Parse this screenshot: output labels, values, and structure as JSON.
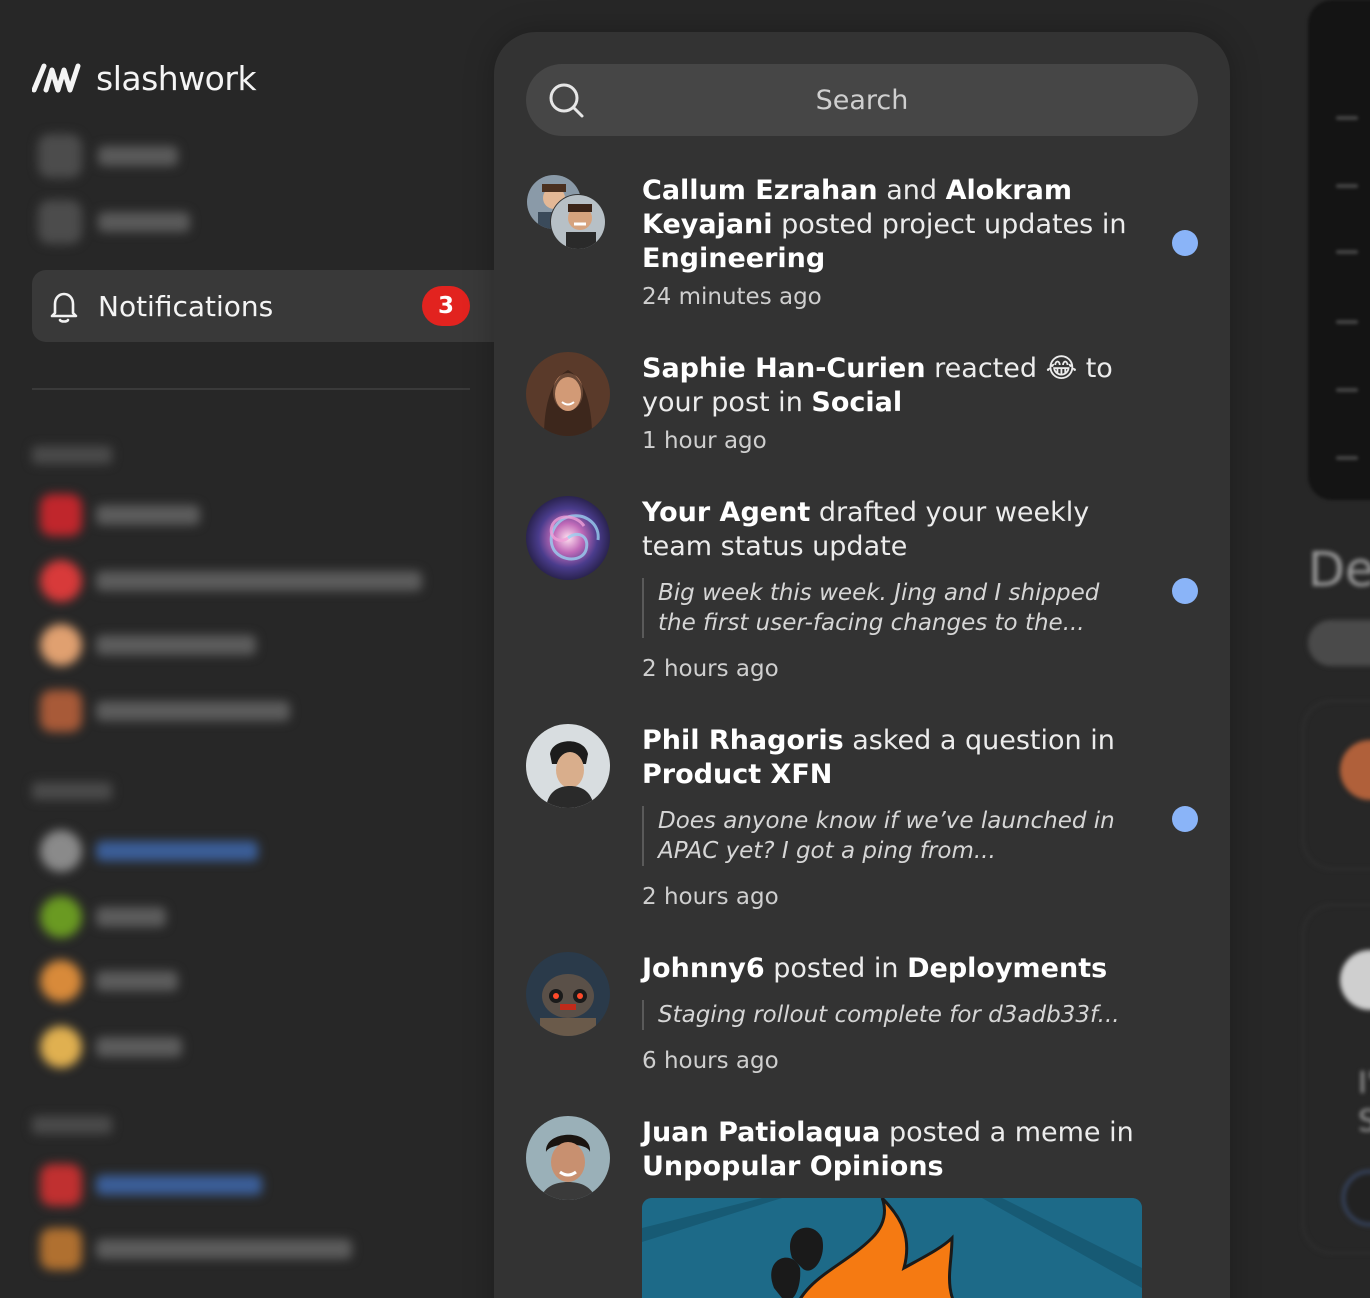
{
  "app": {
    "brand_name": "slashwork",
    "accent": "#8ab4f8",
    "badge_color": "#e2231f"
  },
  "sidebar": {
    "active_item": {
      "label": "Notifications",
      "icon": "bell-icon",
      "badge_count": "3"
    }
  },
  "search": {
    "placeholder": "Search",
    "icon": "search-icon"
  },
  "notifications": [
    {
      "parts": [
        {
          "t": "Callum Ezrahan",
          "b": true
        },
        {
          "t": " and ",
          "b": false
        },
        {
          "t": "Alokram Keyajani",
          "b": true
        },
        {
          "t": " posted project updates in ",
          "b": false
        },
        {
          "t": "Engineering",
          "b": true
        }
      ],
      "time": "24 minutes ago",
      "unread": true
    },
    {
      "parts": [
        {
          "t": "Saphie Han-Curien",
          "b": true
        },
        {
          "t": " reacted 😂 to your post in ",
          "b": false
        },
        {
          "t": "Social",
          "b": true
        }
      ],
      "time": "1 hour ago",
      "unread": false
    },
    {
      "parts": [
        {
          "t": "Your Agent",
          "b": true
        },
        {
          "t": " drafted your weekly team status update",
          "b": false
        }
      ],
      "quote": "Big week this week. Jing and I shipped the first user-facing changes to the...",
      "time": "2 hours ago",
      "unread": true
    },
    {
      "parts": [
        {
          "t": "Phil Rhagoris",
          "b": true
        },
        {
          "t": " asked a question in ",
          "b": false
        },
        {
          "t": "Product XFN",
          "b": true
        }
      ],
      "quote": "Does anyone know if we’ve launched in APAC yet? I got a ping from...",
      "time": "2 hours ago",
      "unread": true
    },
    {
      "parts": [
        {
          "t": "Johnny6",
          "b": true
        },
        {
          "t": " posted in ",
          "b": false
        },
        {
          "t": "Deployments",
          "b": true
        }
      ],
      "quote": "Staging rollout complete for d3adb33f...",
      "time": "6 hours ago",
      "unread": false
    },
    {
      "parts": [
        {
          "t": "Juan Patiolaqua",
          "b": true
        },
        {
          "t": " posted a meme in ",
          "b": false
        },
        {
          "t": "Unpopular Opinions",
          "b": true
        }
      ],
      "time": "",
      "unread": false
    }
  ]
}
